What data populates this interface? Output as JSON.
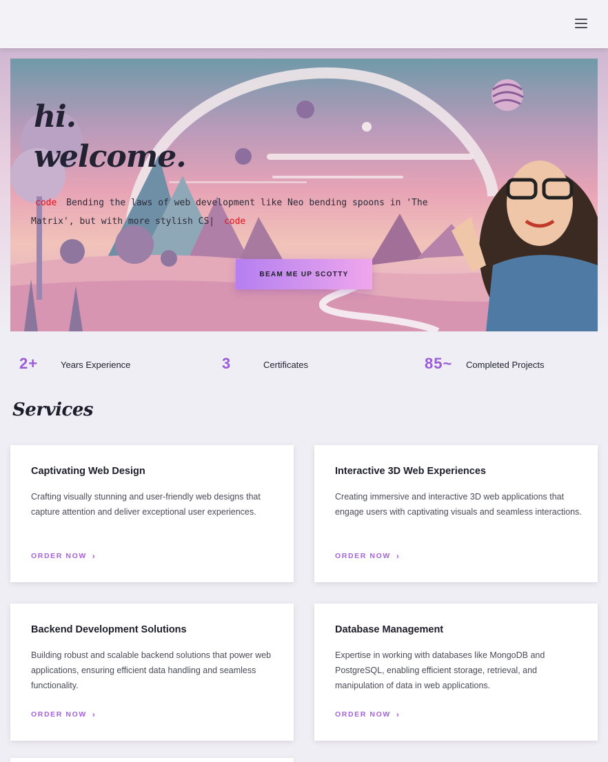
{
  "header": {
    "menu_icon": "hamburger-menu-icon"
  },
  "hero": {
    "greeting_line1": "hi.",
    "greeting_line2": "welcome.",
    "code_tag_open": "code",
    "tagline": "Bending the laws of web development like Neo bending spoons in 'The Matrix', but with more stylish CS|",
    "code_tag_close": "code",
    "cta_label": "BEAM ME UP SCOTTY",
    "colors": {
      "code_tag": "#e0141e",
      "cta_start": "#b57ff0",
      "cta_end": "#f0a6ec"
    }
  },
  "stats": [
    {
      "value": "2+",
      "label": "Years Experience"
    },
    {
      "value": "3",
      "label": "Certificates"
    },
    {
      "value": "85~",
      "label": "Completed Projects"
    }
  ],
  "services": {
    "title": "Services",
    "cards": [
      {
        "title": "Captivating Web Design",
        "description": "Crafting visually stunning and user-friendly web designs that capture attention and deliver exceptional user experiences.",
        "cta": "ORDER NOW",
        "cta_icon": "chevron-right-icon"
      },
      {
        "title": "Interactive 3D Web Experiences",
        "description": "Creating immersive and interactive 3D web applications that engage users with captivating visuals and seamless interactions.",
        "cta": "ORDER NOW",
        "cta_icon": "chevron-right-icon"
      },
      {
        "title": "Backend Development Solutions",
        "description": "Building robust and scalable backend solutions that power web applications, ensuring efficient data handling and seamless functionality.",
        "cta": "ORDER NOW",
        "cta_icon": "chevron-right-icon"
      },
      {
        "title": "Database Management",
        "description": "Expertise in working with databases like MongoDB and PostgreSQL, enabling efficient storage, retrieval, and manipulation of data in web applications.",
        "cta": "ORDER NOW",
        "cta_icon": "chevron-right-icon"
      }
    ]
  },
  "accent_color": "#9a5cd6"
}
